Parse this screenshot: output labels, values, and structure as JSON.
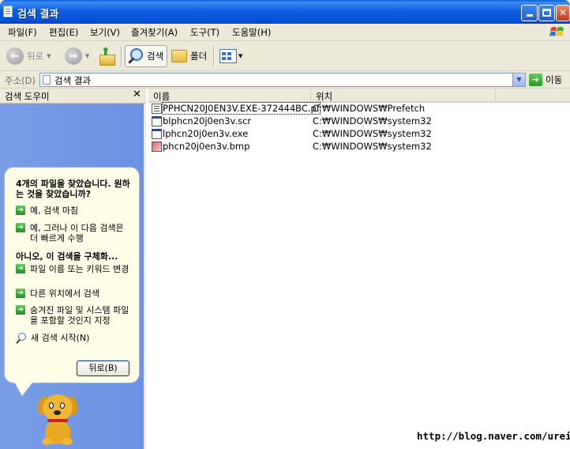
{
  "window": {
    "title": "검색 결과"
  },
  "menu": [
    "파일(F)",
    "편집(E)",
    "보기(V)",
    "즐겨찾기(A)",
    "도구(T)",
    "도움말(H)"
  ],
  "toolbar": {
    "back": "뒤로",
    "search": "검색",
    "folders": "폴더"
  },
  "address": {
    "label": "주소(D)",
    "value": "검색 결과",
    "go": "이동"
  },
  "pane": {
    "title": "검색 도우미",
    "question": "4개의 파일을 찾았습니다. 원하는 것을 찾았습니까?",
    "yes_done": "예, 검색 마침",
    "yes_faster": "예, 그러나 이 다음 검색은 더 빠르게 수행",
    "refine_heading": "아니오, 이 검색을 구체화...",
    "refine_options": [
      "파일 이름 또는 키워드 변경",
      "다른 위치에서 검색",
      "숨겨진 파일 및 시스템 파일을 포함할 것인지 지정"
    ],
    "new_search": "새 검색 시작(N)",
    "back_button": "뒤로(B)"
  },
  "list": {
    "columns": {
      "name": "이름",
      "location": "위치"
    },
    "rows": [
      {
        "name": "PPHCN20J0EN3V.EXE-372444BC.pf",
        "location": "C:₩WINDOWS₩Prefetch",
        "icon": "pf-file-icon"
      },
      {
        "name": "blphcn20j0en3v.scr",
        "location": "C:₩WINDOWS₩system32",
        "icon": "screensaver-file-icon"
      },
      {
        "name": "lphcn20j0en3v.exe",
        "location": "C:₩WINDOWS₩system32",
        "icon": "exe-file-icon"
      },
      {
        "name": "phcn20j0en3v.bmp",
        "location": "C:₩WINDOWS₩system32",
        "icon": "bmp-file-icon"
      }
    ]
  },
  "watermark": "http://blog.naver.com/urein"
}
